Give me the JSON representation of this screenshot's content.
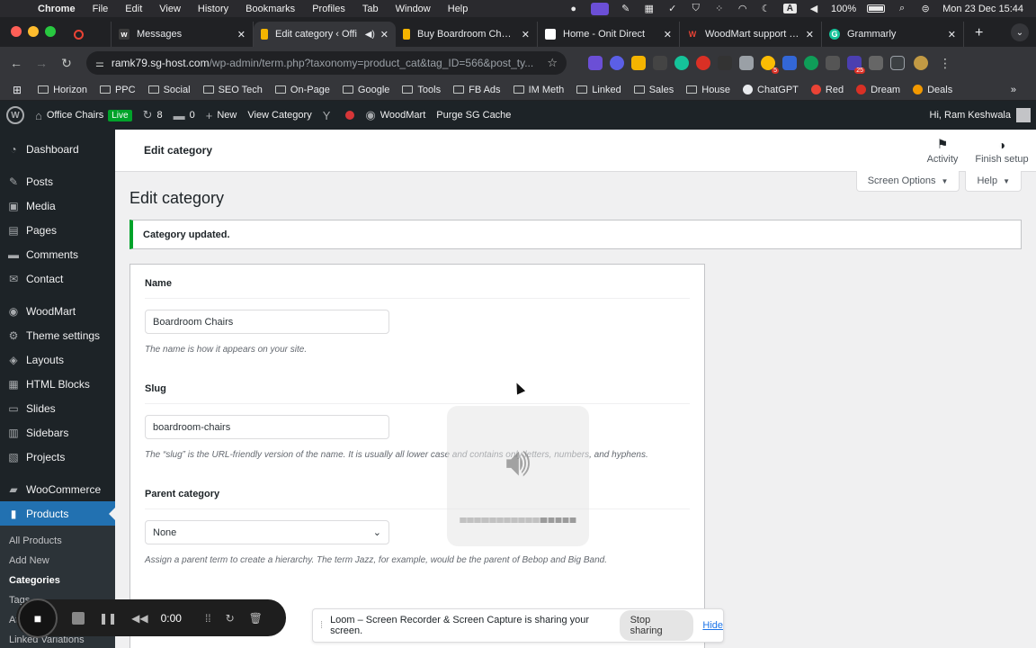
{
  "macos": {
    "app_name": "Chrome",
    "menu": [
      "File",
      "Edit",
      "View",
      "History",
      "Bookmarks",
      "Profiles",
      "Tab",
      "Window",
      "Help"
    ],
    "input_source": "A",
    "battery": "100%",
    "datetime": "Mon 23 Dec  15:44"
  },
  "tabs": [
    {
      "title": "",
      "favicon_color": "#ea4335",
      "active": false,
      "narrow": true
    },
    {
      "title": "Messages",
      "favicon_color": "#3c3c3c",
      "active": false
    },
    {
      "title": "Edit category ‹ Offi",
      "favicon_color": "#f4b400",
      "active": true
    },
    {
      "title": "Buy Boardroom Chairs",
      "favicon_color": "#f4b400",
      "active": false
    },
    {
      "title": "Home - Onit Direct",
      "favicon_color": "#ffffff",
      "active": false
    },
    {
      "title": "WoodMart support for",
      "favicon_color": "#ea4335",
      "active": false
    },
    {
      "title": "Grammarly",
      "favicon_color": "#15c39a",
      "active": false
    }
  ],
  "omnibox": {
    "host": "ramk79.sg-host.com",
    "path": "/wp-admin/term.php?taxonomy=product_cat&tag_ID=566&post_ty..."
  },
  "extensions": {
    "badge_1": "5",
    "badge_2": "25"
  },
  "bookmarks": [
    "Horizon",
    "PPC",
    "Social",
    "SEO Tech",
    "On-Page",
    "Google",
    "Tools",
    "FB Ads",
    "IM Meth",
    "Linked",
    "Sales",
    "House",
    "ChatGPT",
    "Red",
    "Dream",
    "Deals"
  ],
  "adminbar": {
    "site_name": "Office Chairs",
    "live_label": "Live",
    "updates_count": "8",
    "comments_count": "0",
    "new_label": "New",
    "view_category": "View Category",
    "woodmart": "WoodMart",
    "purge": "Purge SG Cache",
    "howdy": "Hi, Ram Keshwala"
  },
  "sidebar": {
    "items": [
      {
        "label": "Dashboard",
        "icon": "◔"
      },
      {
        "label": "Posts",
        "icon": "✎"
      },
      {
        "label": "Media",
        "icon": "▣"
      },
      {
        "label": "Pages",
        "icon": "▤"
      },
      {
        "label": "Comments",
        "icon": "▬"
      },
      {
        "label": "Contact",
        "icon": "✉"
      },
      {
        "label": "WoodMart",
        "icon": "◉"
      },
      {
        "label": "Theme settings",
        "icon": "⚙"
      },
      {
        "label": "Layouts",
        "icon": "◈"
      },
      {
        "label": "HTML Blocks",
        "icon": "▦"
      },
      {
        "label": "Slides",
        "icon": "▭"
      },
      {
        "label": "Sidebars",
        "icon": "▥"
      },
      {
        "label": "Projects",
        "icon": "▧"
      },
      {
        "label": "WooCommerce",
        "icon": "▰"
      },
      {
        "label": "Products",
        "icon": "▮"
      }
    ],
    "submenu": [
      "All Products",
      "Add New",
      "Categories",
      "Tags",
      "Attributes",
      "Linked Variations"
    ]
  },
  "header": {
    "title": "Edit category",
    "activity": "Activity",
    "finish_setup": "Finish setup",
    "screen_options": "Screen Options",
    "help": "Help"
  },
  "page": {
    "heading": "Edit category",
    "notice": "Category updated."
  },
  "form": {
    "name_label": "Name",
    "name_value": "Boardroom Chairs",
    "name_desc": "The name is how it appears on your site.",
    "slug_label": "Slug",
    "slug_value": "boardroom-chairs",
    "slug_desc": "The “slug” is the URL-friendly version of the name. It is usually all lower case and contains only letters, numbers, and hyphens.",
    "parent_label": "Parent category",
    "parent_value": "None",
    "parent_desc": "Assign a parent term to create a hierarchy. The term Jazz, for example, would be the parent of Bebop and Big Band."
  },
  "volume": {
    "level_cells_on": 5,
    "level_cells_total": 16
  },
  "loom": {
    "timer": "0:00",
    "share_msg": "Loom – Screen Recorder & Screen Capture is sharing your screen.",
    "stop_sharing": "Stop sharing",
    "hide": "Hide"
  }
}
